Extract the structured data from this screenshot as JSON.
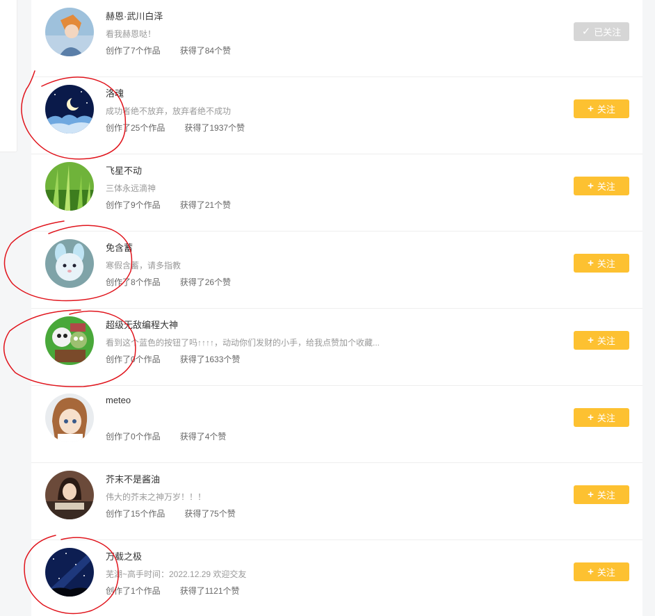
{
  "users": [
    {
      "name": "赫恩·武川白泽",
      "bio": "看我赫恩哒！",
      "works": "创作了7个作品",
      "likes": "获得了84个赞",
      "button": "已关注",
      "button_icon": "check-icon",
      "followed": true
    },
    {
      "name": "洛魂",
      "bio": "成功者绝不放弃，放弃者绝不成功",
      "works": "创作了25个作品",
      "likes": "获得了1937个赞",
      "button": "关注",
      "button_icon": "plus-icon",
      "followed": false
    },
    {
      "name": "飞星不动",
      "bio": "三体永远滴神",
      "works": "创作了9个作品",
      "likes": "获得了21个赞",
      "button": "关注",
      "button_icon": "plus-icon",
      "followed": false
    },
    {
      "name": "免含蓄",
      "bio": "寒假含蓄，请多指教",
      "works": "创作了8个作品",
      "likes": "获得了26个赞",
      "button": "关注",
      "button_icon": "plus-icon",
      "followed": false
    },
    {
      "name": "超级无敌编程大神",
      "bio": "看到这个蓝色的按钮了吗↑↑↑↑，动动你们发财的小手，给我点赞加个收藏...",
      "works": "创作了0个作品",
      "likes": "获得了1633个赞",
      "button": "关注",
      "button_icon": "plus-icon",
      "followed": false
    },
    {
      "name": "meteo",
      "bio": "",
      "works": "创作了0个作品",
      "likes": "获得了4个赞",
      "button": "关注",
      "button_icon": "plus-icon",
      "followed": false
    },
    {
      "name": "芥末不是酱油",
      "bio": "伟大的芥末之神万岁！！！",
      "works": "创作了15个作品",
      "likes": "获得了75个赞",
      "button": "关注",
      "button_icon": "plus-icon",
      "followed": false
    },
    {
      "name": "万载之极",
      "bio": "芜湖~高手时间：2022.12.29 欢迎交友",
      "works": "创作了1个作品",
      "likes": "获得了1121个赞",
      "button": "关注",
      "button_icon": "plus-icon",
      "followed": false
    }
  ],
  "colors": {
    "follow_button": "#fdc131",
    "followed_button": "#d6d6d6",
    "annotation": "#e0141c"
  }
}
